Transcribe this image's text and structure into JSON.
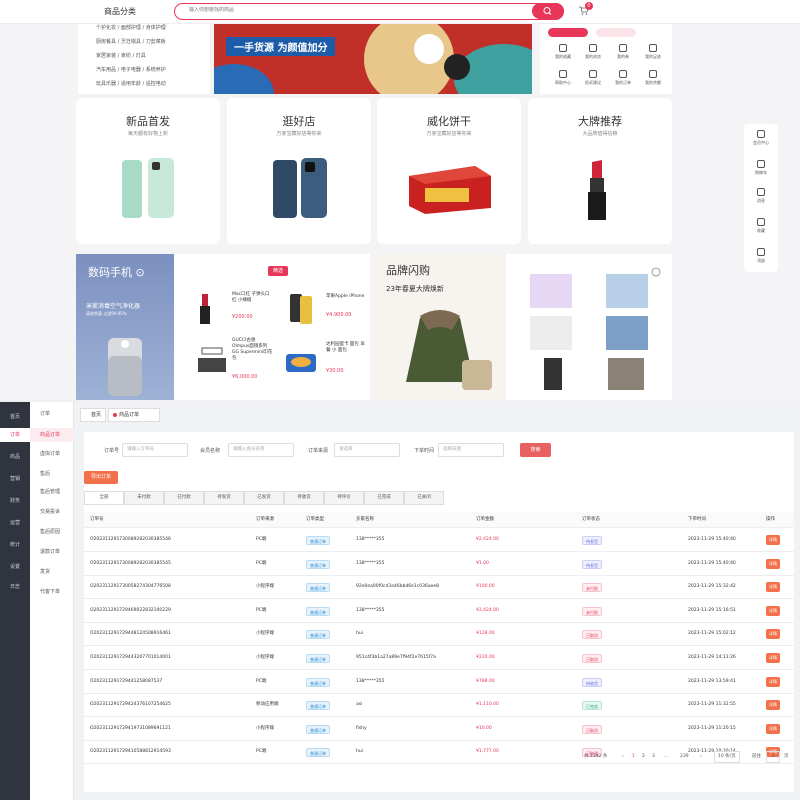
{
  "store": {
    "category_label": "商品分类",
    "search_placeholder": "输入你想要找的商品",
    "cart_count": "0",
    "left_categories": [
      "个护化妆 / 面部护理 / 身体护理",
      "厨房餐具 / 烹饪锅具 / 刀剪菜板",
      "家居家装 / 家纺 / 灯具",
      "汽车用品 / 电子电器 / 系统养护",
      "玩具乐器 / 适用年龄 / 遥控电动"
    ],
    "banner_text": "一手货源  为颜值加分",
    "quick_items": [
      "我的收藏",
      "我的浏览",
      "我的券",
      "我的足迹",
      "帮助中心",
      "投诉建议",
      "我的订单",
      "我的余额"
    ],
    "promos": [
      {
        "title": "新品首发",
        "subtitle": "每天都有好物上新"
      },
      {
        "title": "逛好店",
        "subtitle": "万家宝藏好店等你来"
      },
      {
        "title": "威化饼干",
        "subtitle": "万家宝藏好店等你来"
      },
      {
        "title": "大牌推荐",
        "subtitle": "大品牌值得信赖"
      }
    ],
    "digital": {
      "title": "数码手机 ⊙",
      "sub1": "米家消毒空气净化器",
      "sub2": "高效杀菌 过滤99.95%",
      "tag": "精选",
      "products": [
        {
          "name": "Mac口红 子弹头口红 小辣椒",
          "price": "¥200.00"
        },
        {
          "name": "苹果Apple iPhone",
          "price": "¥4,900.00"
        },
        {
          "name": "GUCCI古驰 Olmpus面镜系列GG Supermini印花包",
          "price": "¥6,000.00"
        },
        {
          "name": "达利园蛋卡 面包 早餐 小 面包",
          "price": "¥30.00"
        }
      ]
    },
    "brand": {
      "title": "品牌闪购",
      "subtitle": "23年春夏大牌焕新"
    },
    "float_items": [
      "会员中心",
      "购物车",
      "消息",
      "收藏",
      "顶部"
    ]
  },
  "admin": {
    "nav": [
      "首页",
      "订单",
      "商品",
      "营销",
      "财务",
      "运营",
      "统计",
      "设置",
      "日志"
    ],
    "active_nav": 1,
    "sub_group": "订单",
    "sub_items": [
      "商品订单",
      "虚拟订单",
      "售后",
      "售后管理",
      "交易投诉",
      "售后原因",
      "退款订单",
      "发货",
      "代客下单"
    ],
    "active_sub": 0,
    "tabs": [
      "首页",
      "商品订单"
    ],
    "filters": [
      {
        "label": "订单号",
        "placeholder": "请输入订单号"
      },
      {
        "label": "会员名称",
        "placeholder": "请输入会员名称"
      },
      {
        "label": "订单来源",
        "placeholder": "请选择"
      },
      {
        "label": "下单时间",
        "placeholder": "选择日期"
      }
    ],
    "search_label": "搜索",
    "export_label": "导出订单",
    "status_tabs": [
      "全部",
      "未付款",
      "已付款",
      "待发货",
      "已发货",
      "待收货",
      "待评价",
      "已完成",
      "已关闭"
    ],
    "columns": [
      "订单号",
      "订单来源",
      "订单类型",
      "买家名称",
      "订单金额",
      "订单状态",
      "下单时间",
      "操作"
    ],
    "rows": [
      {
        "no": "O202311291730089282030385546",
        "source": "PC端",
        "type": "普通订单",
        "buyer": "138*****355",
        "amount": "¥2,424.00",
        "status": "待发货",
        "time": "2023-11-29 15:40:40"
      },
      {
        "no": "O202311291730089282030385545",
        "source": "PC端",
        "type": "普通订单",
        "buyer": "138*****355",
        "amount": "¥1.00",
        "status": "待发货",
        "time": "2023-11-29 15:40:40"
      },
      {
        "no": "O202311291730058274304776508",
        "source": "小程序端",
        "type": "普通订单",
        "buyer": "92e0ea00f0cd3a46bbd6e1c036aee8",
        "amount": "¥100.00",
        "status": "未付款",
        "time": "2023-11-29 15:32:42"
      },
      {
        "no": "O202311291729469022832100229",
        "source": "PC端",
        "type": "普通订单",
        "buyer": "138*****355",
        "amount": "¥2,424.00",
        "status": "未付款",
        "time": "2023-11-29 15:16:51"
      },
      {
        "no": "O202311291729448124508916461",
        "source": "小程序端",
        "type": "普通订单",
        "buyer": "hui",
        "amount": "¥128.00",
        "status": "已取消",
        "time": "2023-11-29 15:02:12"
      },
      {
        "no": "O202311291729443207701014001",
        "source": "小程序端",
        "type": "普通订单",
        "buyer": "951c4f3b1a27a89e7f94f2e7615f7a",
        "amount": "¥220.00",
        "status": "已取消",
        "time": "2023-11-29 14:11:26"
      },
      {
        "no": "O202311291729441258087537",
        "source": "PC端",
        "type": "普通订单",
        "buyer": "138*****355",
        "amount": "¥788.00",
        "status": "待收货",
        "time": "2023-11-29 13:59:41"
      },
      {
        "no": "O202311291729424376107254625",
        "source": "移动应用端",
        "type": "普通订单",
        "buyer": "asi",
        "amount": "¥1,110.00",
        "status": "已完成",
        "time": "2023-11-29 11:32:55"
      },
      {
        "no": "O202311291729419731089691121",
        "source": "小程序端",
        "type": "普通订单",
        "buyer": "fishy",
        "amount": "¥10.00",
        "status": "已取消",
        "time": "2023-11-29 11:20:15"
      },
      {
        "no": "O202311291729410588812914593",
        "source": "PC端",
        "type": "普通订单",
        "buyer": "hui",
        "amount": "¥1,777.00",
        "status": "已取消",
        "time": "2023-11-29 10:30:14"
      }
    ],
    "op_label": "详情",
    "pager": {
      "total": "共 2392 条",
      "pages": [
        "1",
        "2",
        "3",
        "...",
        "239"
      ],
      "page_size": "10 条/页",
      "goto": "前往",
      "goto_value": "1",
      "goto_unit": "页"
    }
  }
}
